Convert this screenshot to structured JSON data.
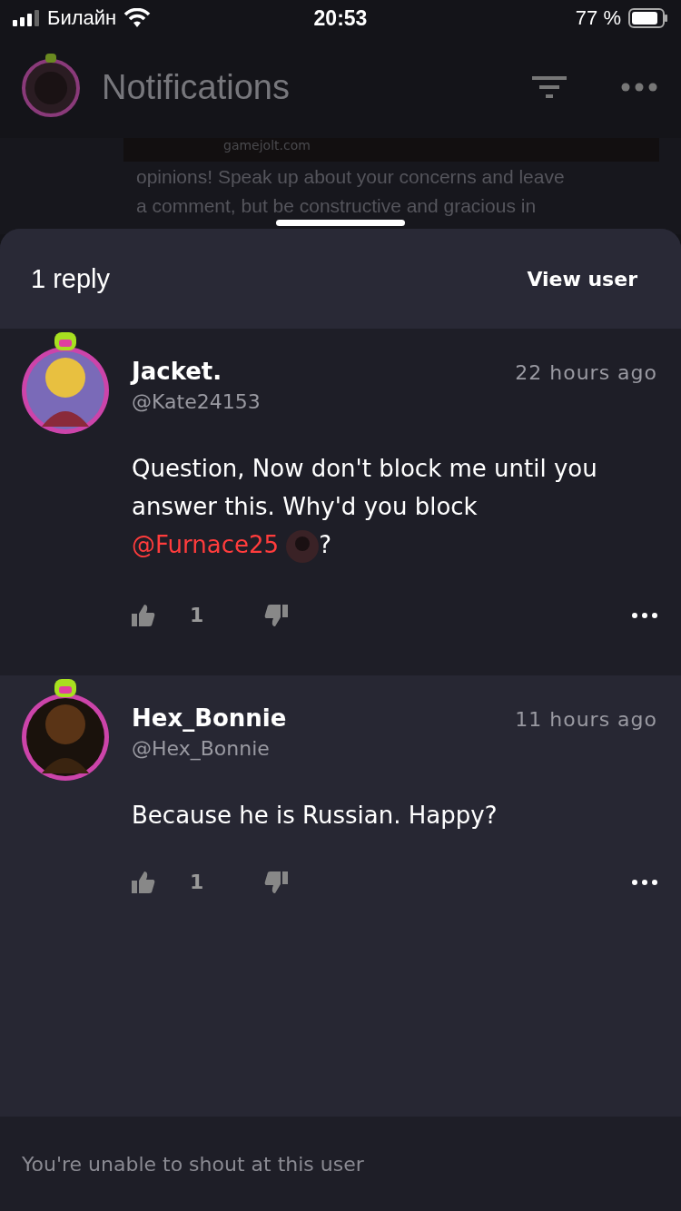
{
  "status_bar": {
    "carrier": "Билайн",
    "time": "20:53",
    "battery": "77 %"
  },
  "header": {
    "title": "Notifications"
  },
  "background_post": {
    "caption": "gamejolt.com",
    "lines": [
      "opinions! Speak up about your concerns and leave",
      "a comment, but be constructive and gracious in"
    ]
  },
  "sheet": {
    "title": "1 reply",
    "action": "View user"
  },
  "comments": [
    {
      "name": "Jacket.",
      "handle": "@Kate24153",
      "time": "22 hours ago",
      "likes": "1",
      "body": [
        {
          "kind": "text",
          "text": "Question, Now don't block me until you answer this. Why'd you block "
        },
        {
          "kind": "mention",
          "text": "@Furnace25"
        },
        {
          "kind": "text",
          "text": "?"
        }
      ]
    },
    {
      "name": "Hex_Bonnie",
      "handle": "@Hex_Bonnie",
      "time": "11 hours ago",
      "likes": "1",
      "body": [
        {
          "kind": "text",
          "text": "Because he is Russian. Happy?"
        }
      ]
    }
  ],
  "footer": {
    "notice": "You're unable to shout at this user"
  }
}
